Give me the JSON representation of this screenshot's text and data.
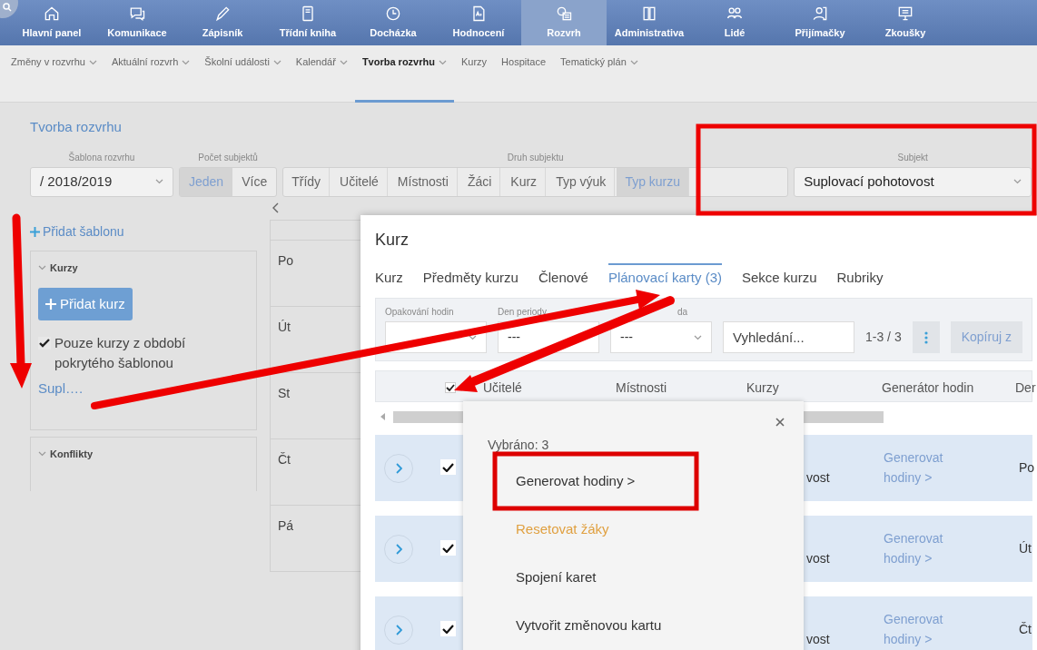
{
  "main_nav": [
    {
      "label": "Hlavní panel",
      "selected": false
    },
    {
      "label": "Komunikace",
      "selected": false
    },
    {
      "label": "Zápisník",
      "selected": false
    },
    {
      "label": "Třídní kniha",
      "selected": false
    },
    {
      "label": "Docházka",
      "selected": false
    },
    {
      "label": "Hodnocení",
      "selected": false
    },
    {
      "label": "Rozvrh",
      "selected": true
    },
    {
      "label": "Administrativa",
      "selected": false
    },
    {
      "label": "Lidé",
      "selected": false
    },
    {
      "label": "Přijímačky",
      "selected": false
    },
    {
      "label": "Zkoušky",
      "selected": false
    }
  ],
  "sub_nav": [
    {
      "label": "Změny v rozvrhu",
      "dropdown": true,
      "selected": false
    },
    {
      "label": "Aktuální rozvrh",
      "dropdown": true,
      "selected": false
    },
    {
      "label": "Školní události",
      "dropdown": true,
      "selected": false
    },
    {
      "label": "Kalendář",
      "dropdown": true,
      "selected": false
    },
    {
      "label": "Tvorba rozvrhu",
      "dropdown": true,
      "selected": true
    },
    {
      "label": "Kurzy",
      "dropdown": false,
      "selected": false
    },
    {
      "label": "Hospitace",
      "dropdown": false,
      "selected": false
    },
    {
      "label": "Tematický plán",
      "dropdown": true,
      "selected": false
    }
  ],
  "page_title": "Tvorba rozvrhu",
  "template": {
    "label": "Šablona rozvrhu",
    "value": "/ 2018/2019"
  },
  "subject_count": {
    "label": "Počet subjektů",
    "options": [
      {
        "label": "Jeden",
        "selected": true
      },
      {
        "label": "Více",
        "selected": false
      }
    ]
  },
  "subject_kind": {
    "label": "Druh subjektu",
    "options": [
      {
        "label": "Třídy",
        "selected": false
      },
      {
        "label": "Učitelé",
        "selected": false
      },
      {
        "label": "Místnosti",
        "selected": false
      },
      {
        "label": "Žáci",
        "selected": false
      },
      {
        "label": "Kurz",
        "selected": false
      },
      {
        "label": "Typ výuk",
        "selected": false
      },
      {
        "label": "Typ kurzu",
        "selected": true
      }
    ]
  },
  "subject": {
    "label": "Subjekt",
    "value": "Suplovací pohotovost"
  },
  "sidebar": {
    "add_template": "Přidat šablonu",
    "courses": {
      "title": "Kurzy",
      "add_button": "Přidat kurz",
      "filter": {
        "label": "Pouze kurzy z období pokrytého šablonou",
        "checked": true
      },
      "items": [
        "Supl…."
      ]
    },
    "conflicts": {
      "title": "Konflikty"
    }
  },
  "days": [
    "Po",
    "Út",
    "St",
    "Čt",
    "Pá"
  ],
  "dialog": {
    "title": "Kurz",
    "tabs": [
      {
        "label": "Kurz",
        "selected": false
      },
      {
        "label": "Předměty kurzu",
        "selected": false
      },
      {
        "label": "Členové",
        "selected": false
      },
      {
        "label": "Plánovací karty (3)",
        "selected": true
      },
      {
        "label": "Sekce kurzu",
        "selected": false
      },
      {
        "label": "Rubriky",
        "selected": false
      }
    ],
    "filters": [
      {
        "label": "Opakování hodin"
      },
      {
        "label": "Den periody",
        "value": "---"
      },
      {
        "label": "da",
        "value": "---"
      }
    ],
    "search": {
      "placeholder": "Vyhledání..."
    },
    "count": "1-3 / 3",
    "copy_button": "Kopíruj z",
    "table": {
      "all_checked": true,
      "columns": [
        "Učitelé",
        "Místnosti",
        "Kurzy",
        "Generátor hodin",
        "Der"
      ],
      "rows": [
        {
          "checked": true,
          "kurzy": "vost",
          "generator": "Generovat hodiny >",
          "day": "Po"
        },
        {
          "checked": true,
          "kurzy": "vost",
          "generator": "Generovat hodiny >",
          "day": "Út"
        },
        {
          "checked": true,
          "kurzy": "vost",
          "generator": "Generovat hodiny >",
          "day": "Čt"
        }
      ]
    }
  },
  "popup": {
    "title": "Vybráno: 3",
    "items": [
      {
        "label": "Generovat hodiny >",
        "kind": "normal"
      },
      {
        "label": "Resetovat žáky",
        "kind": "warning"
      },
      {
        "label": "Spojení karet",
        "kind": "normal"
      },
      {
        "label": "Vytvořit změnovou kartu",
        "kind": "normal"
      }
    ]
  }
}
